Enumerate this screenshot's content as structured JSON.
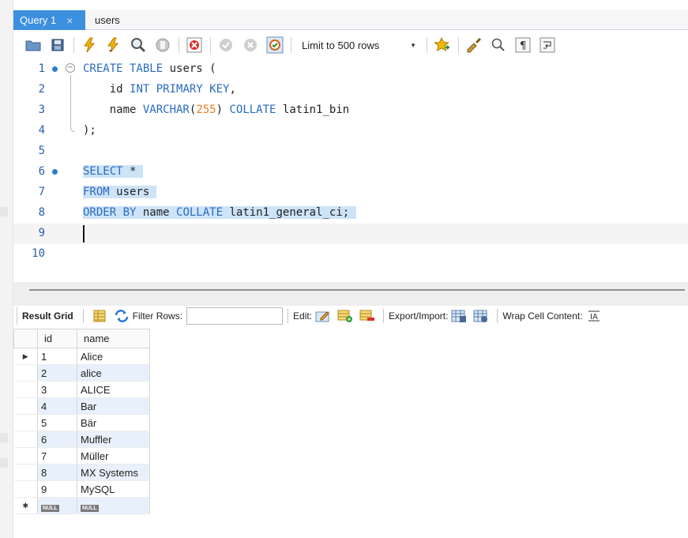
{
  "tabs": [
    {
      "label": "Query 1",
      "active": true,
      "close_glyph": "×"
    },
    {
      "label": "users",
      "active": false
    }
  ],
  "toolbar": {
    "icons": [
      "open-folder-icon",
      "save-icon",
      "execute-icon",
      "execute-cursor-icon",
      "explain-icon",
      "stop-icon",
      "toggle-error-icon",
      "commit-icon",
      "rollback-icon",
      "autocommit-icon"
    ],
    "limit_label": "Limit to 500 rows",
    "icons_after": [
      "bookmark-icon",
      "beautify-icon",
      "find-icon",
      "invisible-chars-icon",
      "wrap-icon"
    ]
  },
  "editor": {
    "lines": [
      {
        "n": "1",
        "text": ""
      },
      {
        "n": "2",
        "text": ""
      },
      {
        "n": "3",
        "text": ""
      },
      {
        "n": "4",
        "text": ""
      },
      {
        "n": "5",
        "text": ""
      },
      {
        "n": "6",
        "text": ""
      },
      {
        "n": "7",
        "text": ""
      },
      {
        "n": "8",
        "text": ""
      },
      {
        "n": "9",
        "text": ""
      },
      {
        "n": "10",
        "text": ""
      }
    ],
    "tokens": {
      "l1a": "CREATE TABLE",
      "l1b": " users (",
      "l2a": "    id ",
      "l2b": "INT PRIMARY KEY",
      "l2c": ",",
      "l3a": "    name ",
      "l3b": "VARCHAR",
      "l3c": "(",
      "l3d": "255",
      "l3e": ") ",
      "l3f": "COLLATE",
      "l3g": " latin1_bin",
      "l4a": ");",
      "l6a": "SELECT",
      "l6b": " *",
      "l7a": "FROM",
      "l7b": " users",
      "l8a": "ORDER BY",
      "l8b": " name ",
      "l8c": "COLLATE",
      "l8d": " latin1_general_ci;"
    }
  },
  "result_toolbar": {
    "result_grid_label": "Result Grid",
    "filter_label": "Filter Rows:",
    "filter_value": "",
    "edit_label": "Edit:",
    "export_label": "Export/Import:",
    "wrap_label": "Wrap Cell Content:"
  },
  "grid": {
    "columns": [
      "id",
      "name"
    ],
    "rows": [
      [
        "1",
        "Alice"
      ],
      [
        "2",
        "alice"
      ],
      [
        "3",
        "ALICE"
      ],
      [
        "4",
        "Bar"
      ],
      [
        "5",
        "Bär"
      ],
      [
        "6",
        "Muffler"
      ],
      [
        "7",
        "Müller"
      ],
      [
        "8",
        "MX Systems"
      ],
      [
        "9",
        "MySQL"
      ]
    ],
    "null_label": "NULL",
    "current_row_marker": "▶",
    "new_row_marker": "✱"
  }
}
